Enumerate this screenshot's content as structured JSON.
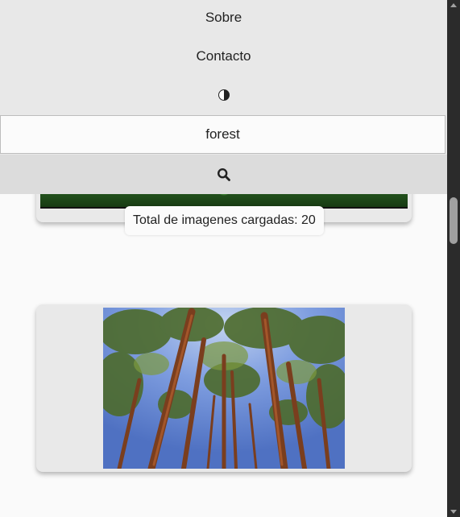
{
  "menu": {
    "items": [
      {
        "label": "Sobre"
      },
      {
        "label": "Contacto"
      }
    ],
    "theme_toggle_icon": "half-circle-contrast-icon"
  },
  "search": {
    "value": "forest",
    "button_icon": "search-icon"
  },
  "gallery": {
    "total_label": "Total de imagenes cargadas: 20"
  },
  "colors": {
    "menu_bg": "#e8e8e8",
    "search_button_bg": "#dcdcdc",
    "card_bg": "#e9e9e9",
    "page_bg": "#fafafa",
    "scrollbar_bg": "#2b2b2b"
  }
}
